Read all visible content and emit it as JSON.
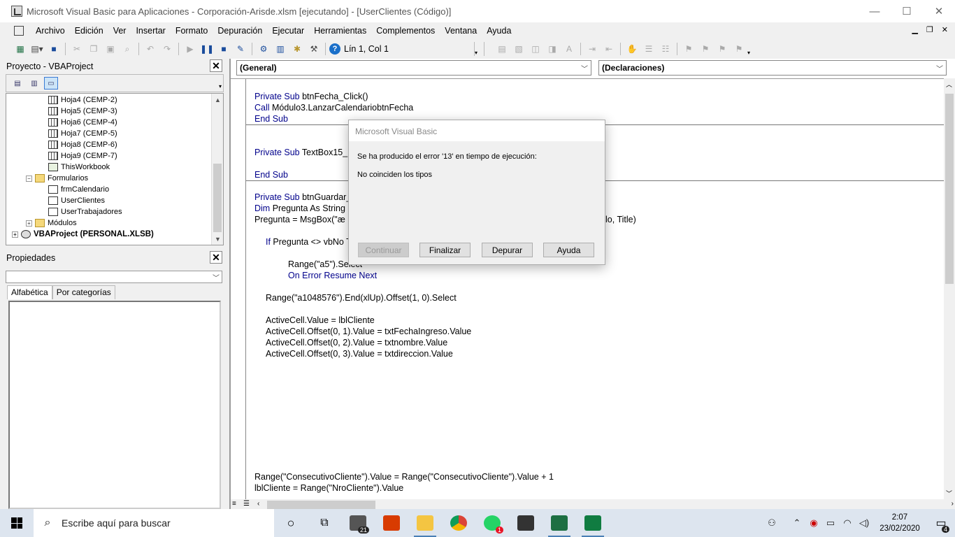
{
  "window": {
    "title": "Microsoft Visual Basic para Aplicaciones - Corporación-Arisde.xlsm [ejecutando] - [UserClientes (Código)]",
    "minimize": "—",
    "maximize": "☐",
    "close": "✕"
  },
  "menu": {
    "items": [
      "Archivo",
      "Edición",
      "Ver",
      "Insertar",
      "Formato",
      "Depuración",
      "Ejecutar",
      "Herramientas",
      "Complementos",
      "Ventana",
      "Ayuda"
    ],
    "mdi_min": "▁",
    "mdi_restore": "❐",
    "mdi_close": "✕"
  },
  "toolbar": {
    "position": "Lín 1, Col 1",
    "help": "?"
  },
  "project": {
    "header": "Proyecto - VBAProject",
    "close": "✕",
    "tree": [
      "Hoja4 (CEMP-2)",
      "Hoja5 (CEMP-3)",
      "Hoja6 (CEMP-4)",
      "Hoja7 (CEMP-5)",
      "Hoja8 (CEMP-6)",
      "Hoja9 (CEMP-7)",
      "ThisWorkbook",
      "Formularios",
      "frmCalendario",
      "UserClientes",
      "UserTrabajadores",
      "Módulos",
      "VBAProject (PERSONAL.XLSB)"
    ]
  },
  "properties": {
    "header": "Propiedades",
    "close": "✕",
    "tab_alpha": "Alfabética",
    "tab_cat": "Por categorías"
  },
  "code": {
    "object_combo": "(General)",
    "proc_combo": "(Declaraciones)",
    "lines": [
      {
        "kw": "Private Sub",
        "rest": " btnFecha_Click()"
      },
      {
        "kw": "Call",
        "rest": " Módulo3.LanzarCalendariobtnFecha"
      },
      {
        "kw": "End Sub",
        "rest": ""
      },
      {
        "kw": "Private Sub",
        "rest": " TextBox15_"
      },
      {
        "kw": "End Sub",
        "rest": ""
      },
      {
        "kw": "Private Sub",
        "rest": " btnGuardar_"
      },
      {
        "kw": "Dim",
        "rest": " Pregunta As String"
      },
      {
        "kw": "",
        "rest": "Pregunta = MsgBox(\"æ"
      },
      {
        "kw": "",
        "rest": "lo, Title)"
      },
      {
        "kw": "If",
        "rest": " Pregunta <> vbNo T"
      },
      {
        "kw": "",
        "rest": "Range(\"a5\").Select"
      },
      {
        "kw": "On Error Resume Next",
        "rest": ""
      },
      {
        "kw": "",
        "rest": "Range(\"a1048576\").End(xlUp).Offset(1, 0).Select"
      },
      {
        "kw": "",
        "rest": "ActiveCell.Value = lblCliente"
      },
      {
        "kw": "",
        "rest": "ActiveCell.Offset(0, 1).Value = txtFechaIngreso.Value"
      },
      {
        "kw": "",
        "rest": "ActiveCell.Offset(0, 2).Value = txtnombre.Value"
      },
      {
        "kw": "",
        "rest": "ActiveCell.Offset(0, 3).Value = txtdireccion.Value"
      },
      {
        "kw": "",
        "rest": "Range(\"ConsecutivoCliente\").Value = Range(\"ConsecutivoCliente\").Value + 1"
      },
      {
        "kw": "",
        "rest": "lblCliente = Range(\"NroCliente\").Value"
      }
    ]
  },
  "dialog": {
    "title": "Microsoft Visual Basic",
    "message": "Se ha producido el error '13' en tiempo de ejecución:",
    "detail": "No coinciden los tipos",
    "btn_continue": "Continuar",
    "btn_end": "Finalizar",
    "btn_debug": "Depurar",
    "btn_help": "Ayuda"
  },
  "taskbar": {
    "search_placeholder": "Escribe aquí para buscar",
    "mail_badge": "21",
    "whatsapp_badge": "1",
    "time": "2:07",
    "date": "23/02/2020",
    "notif_count": "4"
  }
}
